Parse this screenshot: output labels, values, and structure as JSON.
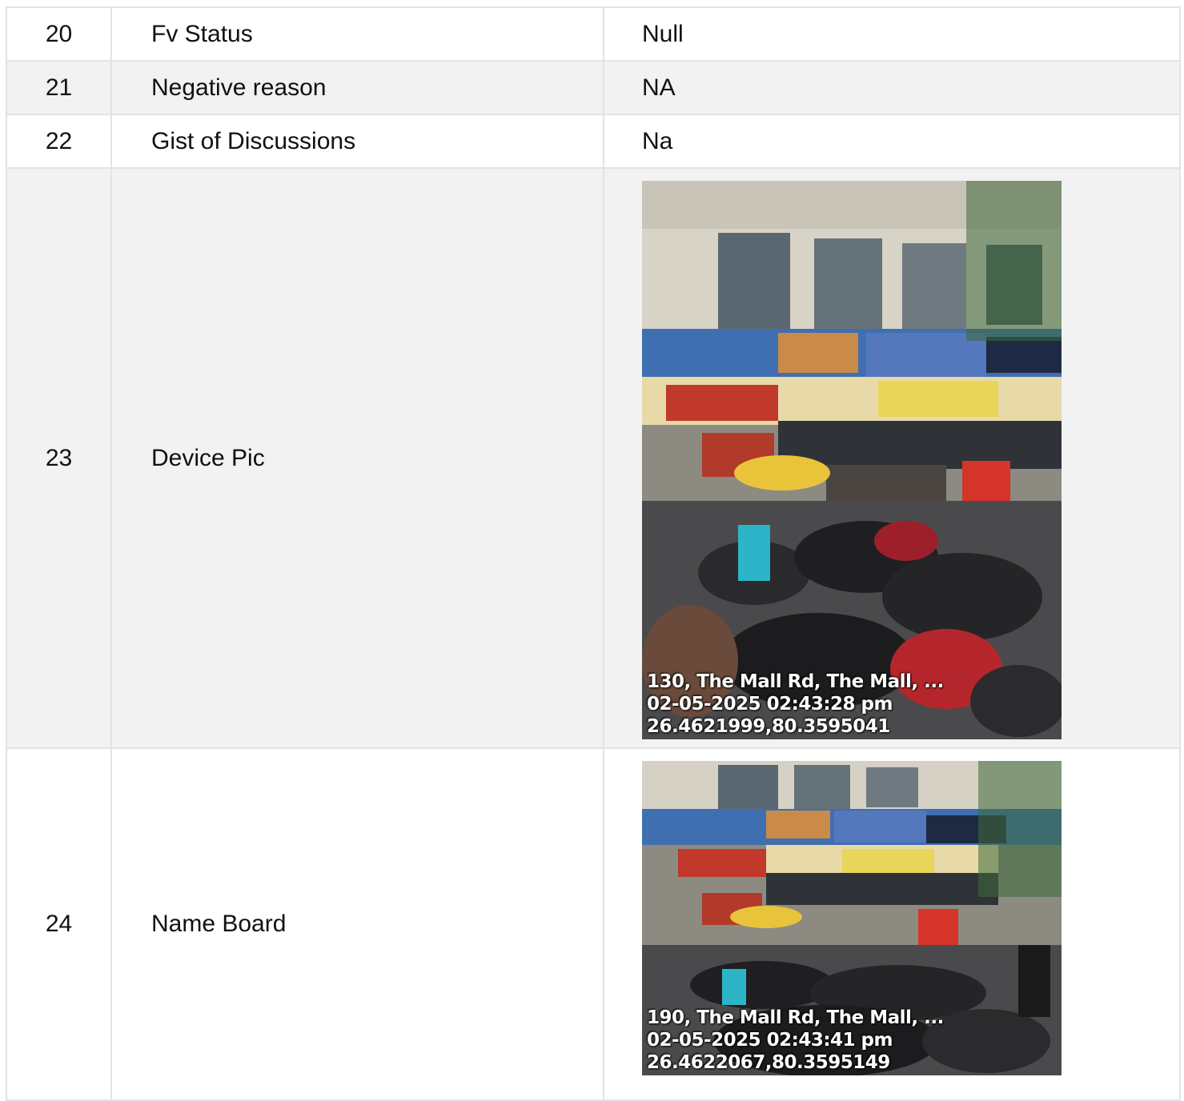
{
  "rows": [
    {
      "no": "20",
      "label": "Fv Status",
      "value": "Null"
    },
    {
      "no": "21",
      "label": "Negative reason",
      "value": "NA"
    },
    {
      "no": "22",
      "label": "Gist of Discussions",
      "value": "Na"
    },
    {
      "no": "23",
      "label": "Device Pic"
    },
    {
      "no": "24",
      "label": "Name Board"
    }
  ],
  "device_pic": {
    "stamp_address": "130, The Mall Rd, The Mall, ...",
    "stamp_datetime": "02-05-2025 02:43:28 pm",
    "stamp_coords": "26.4621999,80.3595041"
  },
  "name_board_pic": {
    "stamp_address": "190, The Mall Rd, The Mall, ...",
    "stamp_datetime": "02-05-2025 02:43:41 pm",
    "stamp_coords": "26.4622067,80.3595149"
  },
  "colors": {
    "border": "#e3e3e3",
    "alt_row": "#f2f2f2"
  }
}
